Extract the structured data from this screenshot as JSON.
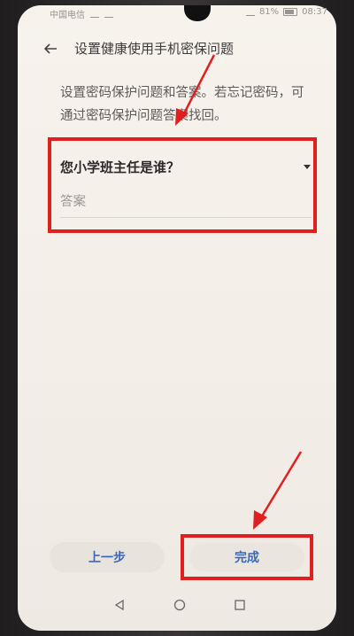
{
  "status_bar": {
    "carrier": "中国电信",
    "battery": "81%",
    "time": "08:37"
  },
  "header": {
    "title": "设置健康使用手机密保问题",
    "back_icon": "arrow-left-icon"
  },
  "description": "设置密码保护问题和答案。若忘记密码，可通过密码保护问题答案找回。",
  "question": {
    "selected": "您小学班主任是谁？",
    "answer_placeholder": "答案"
  },
  "buttons": {
    "prev_label": "上一步",
    "done_label": "完成"
  },
  "colors": {
    "accent": "#3a68b8",
    "highlight": "#e02020"
  }
}
